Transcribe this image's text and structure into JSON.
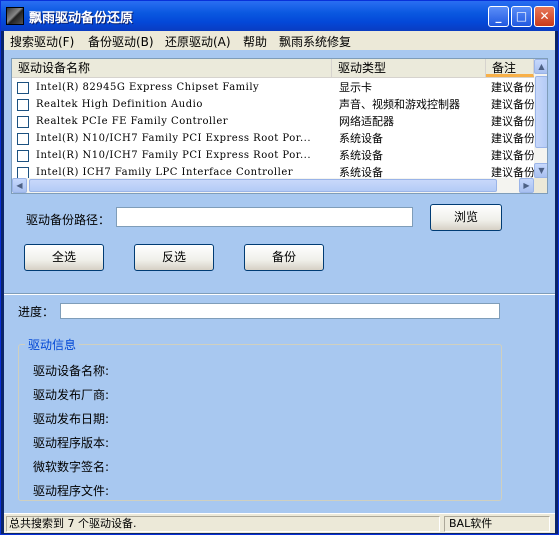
{
  "window": {
    "title": "飘雨驱动备份还原"
  },
  "menu": [
    "搜索驱动(F)",
    "备份驱动(B)",
    "还原驱动(A)",
    "帮助",
    "飘雨系统修复"
  ],
  "list": {
    "columns": [
      "驱动设备名称",
      "驱动类型",
      "备注"
    ],
    "rows": [
      {
        "name": "Intel(R) 82945G Express Chipset Family",
        "type": "显示卡",
        "note": "建议备份"
      },
      {
        "name": "Realtek High Definition Audio",
        "type": "声音、视频和游戏控制器",
        "note": "建议备份"
      },
      {
        "name": "Realtek PCIe FE Family Controller",
        "type": "网络适配器",
        "note": "建议备份"
      },
      {
        "name": "Intel(R) N10/ICH7 Family PCI Express Root Por...",
        "type": "系统设备",
        "note": "建议备份"
      },
      {
        "name": "Intel(R) N10/ICH7 Family PCI Express Root Por...",
        "type": "系统设备",
        "note": "建议备份"
      },
      {
        "name": "Intel(R) ICH7 Family LPC Interface Controller",
        "type": "系统设备",
        "note": "建议备份"
      }
    ]
  },
  "backup": {
    "path_label": "驱动备份路径：",
    "path_value": "",
    "browse_label": "浏览"
  },
  "buttons": {
    "select_all": "全选",
    "invert": "反选",
    "backup": "备份"
  },
  "progress": {
    "label": "进度：",
    "value": 0
  },
  "info": {
    "title": "驱动信息",
    "fields": [
      "驱动设备名称:",
      "驱动发布厂商:",
      "驱动发布日期:",
      "驱动程序版本:",
      "微软数字签名:",
      "驱动程序文件:"
    ]
  },
  "status": {
    "left": "总共搜索到 7 个驱动设备.",
    "right": "BAL软件"
  },
  "colors": {
    "title_bar": "#0a58e0",
    "client_bg": "#a8c8f0",
    "group_title": "#0046d5"
  }
}
